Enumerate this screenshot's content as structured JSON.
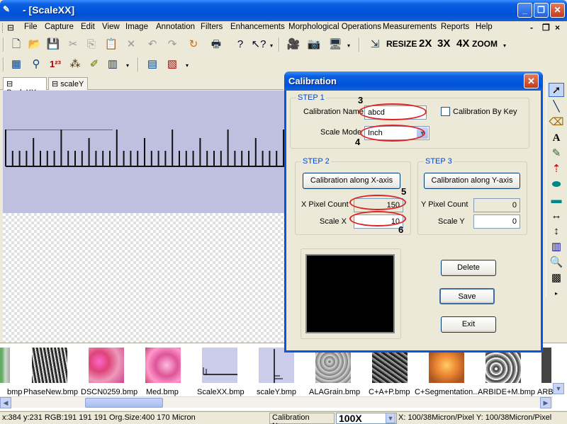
{
  "window": {
    "title": "- [ScaleXX]",
    "app_icon": "app-logo-icon"
  },
  "menu": {
    "items": [
      {
        "label": "File",
        "u": "F"
      },
      {
        "label": "Capture",
        "u": "C"
      },
      {
        "label": "Edit",
        "u": "E"
      },
      {
        "label": "View",
        "u": "V"
      },
      {
        "label": "Image",
        "u": "I"
      },
      {
        "label": "Annotation",
        "u": "A"
      },
      {
        "label": "Filters",
        "u": "l"
      },
      {
        "label": "Enhancements",
        "u": "E"
      },
      {
        "label": "Morphological Operations",
        "u": "M"
      },
      {
        "label": "Measurements",
        "u": "M"
      },
      {
        "label": "Reports",
        "u": "R"
      },
      {
        "label": "Help",
        "u": "H"
      }
    ]
  },
  "toolbar": {
    "resize_label": "RESIZE",
    "zoom_2x": "2X",
    "zoom_3x": "3X",
    "zoom_4x": "4X",
    "zoom_label": "ZOOM"
  },
  "doc_tabs": [
    {
      "label": "ScaleXX",
      "active": true
    },
    {
      "label": "scaleY",
      "active": false
    }
  ],
  "dialog": {
    "title": "Calibration",
    "step1": {
      "label": "STEP 1",
      "calibration_name_label": "Calibration Name",
      "calibration_name_value": "abcd",
      "calibration_by_key_label": "Calibration By Key",
      "scale_mode_label": "Scale Mode",
      "scale_mode_value": "Inch"
    },
    "step2": {
      "label": "STEP 2",
      "button": "Calibration along X-axis",
      "x_pixel_count_label": "X Pixel Count",
      "x_pixel_count_value": "150",
      "scale_x_label": "Scale X",
      "scale_x_value": "10"
    },
    "step3": {
      "label": "STEP 3",
      "button": "Calibration along Y-axis",
      "y_pixel_count_label": "Y Pixel Count",
      "y_pixel_count_value": "0",
      "scale_y_label": "Scale Y",
      "scale_y_value": "0"
    },
    "buttons": {
      "delete": "Delete",
      "save": "Save",
      "exit": "Exit"
    },
    "annotations": [
      "3",
      "4",
      "5",
      "6"
    ]
  },
  "thumbnails": [
    {
      "label": "bmp"
    },
    {
      "label": "PhaseNew.bmp"
    },
    {
      "label": "DSCN0259.bmp"
    },
    {
      "label": "Med.bmp"
    },
    {
      "label": "ScaleXX.bmp"
    },
    {
      "label": "scaleY.bmp"
    },
    {
      "label": "ALAGrain.bmp"
    },
    {
      "label": "C+A+P.bmp"
    },
    {
      "label": "C+Segmentation..."
    },
    {
      "label": "ARBIDE+M.bmp"
    },
    {
      "label": "ARB"
    }
  ],
  "status": {
    "coords": "x:384 y:231 RGB:191 191 191 Org.Size:400 170 Micron",
    "calibration_name": "Calibration Name",
    "zoom": "100X",
    "scale_info": "X: 100/38Micron/Pixel Y: 100/38Micron/Pixel"
  }
}
